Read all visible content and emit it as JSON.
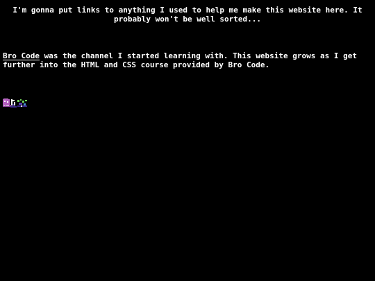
{
  "intro": {
    "text": "I'm gonna put links to anything I used to help me make this website here. It probably won't be well sorted..."
  },
  "bro_code": {
    "link_text": "Bro Code",
    "description": " was the channel I started learning with. This website grows as I get further into the HTML and CSS course provided by Bro Code."
  },
  "badge": {
    "icon": "pixel-art-badge-icon",
    "colors": [
      "#b45fbf",
      "#ffffff",
      "#3b2a8a",
      "#6fd15a"
    ]
  }
}
